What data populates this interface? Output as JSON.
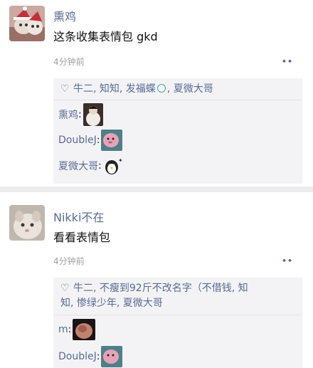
{
  "posts": [
    {
      "author": "熏鸡",
      "text": "这条收集表情包 gkd",
      "time": "4分钟前",
      "more": "••",
      "likes": {
        "heart": "♡",
        "names_before": "牛二, 知知, 发福蝶",
        "names_after": ", 夏微大哥"
      },
      "comments": [
        {
          "author": "熏鸡",
          "colon": ":"
        },
        {
          "author": "DoubleJ",
          "colon": ":"
        },
        {
          "author": "夏微大哥",
          "colon": ":"
        }
      ]
    },
    {
      "author": "Nikki不在",
      "text": "看看表情包",
      "time": "4分钟前",
      "more": "••",
      "likes": {
        "heart": "♡",
        "line1": "牛二, 不瘦到92斤不改名字（不借钱, 知",
        "line2": "知, 惨绿少年, 夏微大哥"
      },
      "comments": [
        {
          "author": "m",
          "colon": ":"
        },
        {
          "author": "DoubleJ",
          "colon": ":"
        }
      ]
    }
  ],
  "colors": {
    "link": "#576b95",
    "bg_comment": "#f3f3f5",
    "divider": "#ececec",
    "time": "#a0a0a0"
  }
}
